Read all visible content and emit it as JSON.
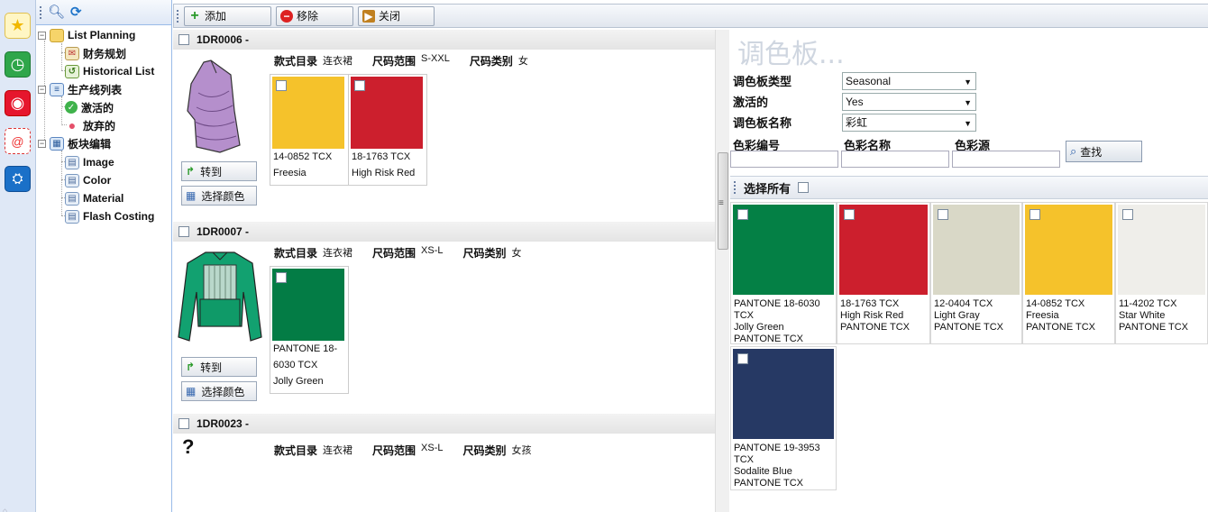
{
  "rail": {
    "icons": [
      "star-icon",
      "clock-icon",
      "weibo-icon",
      "mail-icon",
      "tencent-icon"
    ]
  },
  "tree": {
    "nodes": [
      {
        "label": "List Planning"
      },
      {
        "label": "财务规划"
      },
      {
        "label": "Historical List"
      },
      {
        "label": "生产线列表"
      },
      {
        "label": "激活的"
      },
      {
        "label": "放弃的"
      },
      {
        "label": "板块编辑"
      },
      {
        "label": "Image"
      },
      {
        "label": "Color"
      },
      {
        "label": "Material"
      },
      {
        "label": "Flash Costing"
      }
    ],
    "expander": "−"
  },
  "toolbar": {
    "add_label": "添加",
    "remove_label": "移除",
    "close_label": "关闭"
  },
  "products": [
    {
      "code": "1DR0006 -",
      "category_label": "款式目录",
      "category": "连衣裙",
      "size_range_label": "尺码范围",
      "size_range": "S-XXL",
      "size_type_label": "尺码类别",
      "size_type": "女",
      "goto_label": "转到",
      "pick_color_label": "选择颜色",
      "colors": [
        {
          "hex": "#f5c22b",
          "code": "14-0852 TCX",
          "name": "Freesia"
        },
        {
          "hex": "#cc1f2d",
          "code": "18-1763 TCX",
          "name": "High Risk Red"
        }
      ]
    },
    {
      "code": "1DR0007 -",
      "category_label": "款式目录",
      "category": "连衣裙",
      "size_range_label": "尺码范围",
      "size_range": "XS-L",
      "size_type_label": "尺码类别",
      "size_type": "女",
      "goto_label": "转到",
      "pick_color_label": "选择颜色",
      "colors": [
        {
          "hex": "#037c45",
          "code": "PANTONE 18-",
          "code2": "6030 TCX",
          "name": "Jolly Green"
        }
      ]
    },
    {
      "code": "1DR0023 -",
      "image_placeholder": "?",
      "category_label": "款式目录",
      "category": "连衣裙",
      "size_range_label": "尺码范围",
      "size_range": "XS-L",
      "size_type_label": "尺码类别",
      "size_type": "女孩"
    }
  ],
  "palette": {
    "title": "调色板...",
    "type_label": "调色板类型",
    "type_value": "Seasonal",
    "active_label": "激活的",
    "active_value": "Yes",
    "name_label": "调色板名称",
    "name_value": "彩虹",
    "color_code_label": "色彩编号",
    "color_name_label": "色彩名称",
    "color_source_label": "色彩源",
    "find_label": "查找",
    "select_all_label": "选择所有",
    "swatches": [
      {
        "hex": "#048045",
        "l1": "PANTONE 18-6030",
        "l2": "TCX",
        "l3": "Jolly Green",
        "l4": "PANTONE TCX"
      },
      {
        "hex": "#cc1f2d",
        "l1": "18-1763 TCX",
        "l2": "High Risk Red",
        "l3": "PANTONE TCX",
        "l4": ""
      },
      {
        "hex": "#d9d8c7",
        "l1": "12-0404 TCX",
        "l2": "Light Gray",
        "l3": "PANTONE TCX",
        "l4": ""
      },
      {
        "hex": "#f5c22b",
        "l1": "14-0852 TCX",
        "l2": "Freesia",
        "l3": "PANTONE TCX",
        "l4": ""
      },
      {
        "hex": "#efeeea",
        "l1": "11-4202 TCX",
        "l2": "Star White",
        "l3": "PANTONE TCX",
        "l4": ""
      },
      {
        "hex": "#263964",
        "l1": "PANTONE 19-3953",
        "l2": "TCX",
        "l3": "Sodalite Blue",
        "l4": "PANTONE TCX"
      }
    ]
  }
}
